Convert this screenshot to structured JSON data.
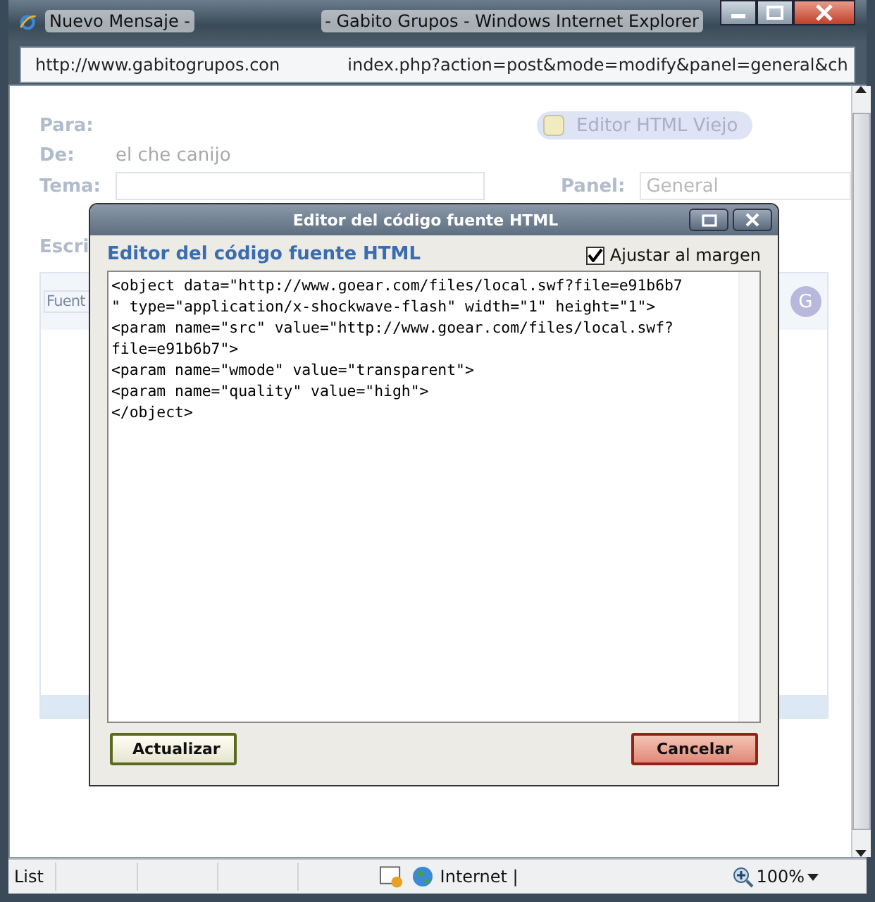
{
  "window": {
    "title_start": "Nuevo Mensaje -",
    "title_end": "- Gabito Grupos - Windows Internet Explorer"
  },
  "address_bar": {
    "url_start": "http://www.gabitogrupos.con",
    "url_end": "index.php?action=post&mode=modify&panel=general&ch"
  },
  "form": {
    "para_label": "Para:",
    "de_label": "De:",
    "de_value": "el che canijo",
    "tema_label": "Tema:",
    "panel_label": "Panel:",
    "panel_value": "General",
    "escribe_label": "Escri",
    "old_editor_button": "Editor HTML Viejo",
    "toolbar_font": "Fuent",
    "avatar_letter": "G"
  },
  "dialog": {
    "title": "Editor del código fuente HTML",
    "heading": "Editor del código fuente HTML",
    "wrap_option": {
      "label": "Ajustar al margen",
      "checked": true
    },
    "code_lines": [
      "<object data=\"http://www.goear.com/files/local.swf?file=e91b6b7",
      "\" type=\"application/x-shockwave-flash\" width=\"1\" height=\"1\">",
      "<param name=\"src\" value=\"http://www.goear.com/files/local.swf?",
      "file=e91b6b7\">",
      "<param name=\"wmode\" value=\"transparent\">",
      "<param name=\"quality\" value=\"high\">",
      "</object>"
    ],
    "buttons": [
      {
        "label": "Actualizar",
        "kind": "update"
      },
      {
        "label": "Cancelar",
        "kind": "cancel"
      }
    ]
  },
  "status_bar": {
    "status": "List",
    "zone": "Internet |",
    "zoom": "100%"
  }
}
